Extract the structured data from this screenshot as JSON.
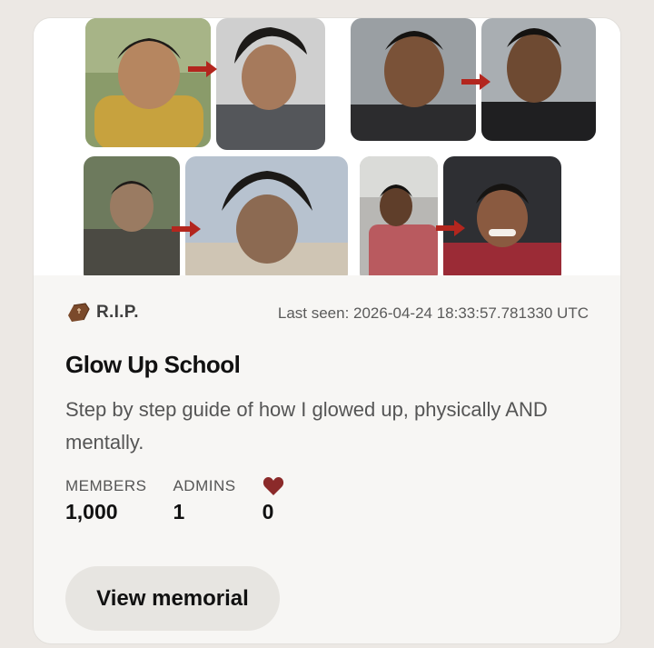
{
  "card": {
    "status_label": "R.I.P.",
    "last_seen": "Last seen: 2026-04-24 18:33:57.781330 UTC",
    "title": "Glow Up School",
    "description": "Step by step guide of how I glowed up, physically AND mentally.",
    "stats": {
      "members_label": "MEMBERS",
      "members_value": "1,000",
      "admins_label": "ADMINS",
      "admins_value": "1",
      "likes_value": "0"
    },
    "button_label": "View memorial"
  },
  "icons": {
    "status": "coffin-icon",
    "likes": "heart-icon",
    "arrows": "red-arrow-icon"
  },
  "colors": {
    "arrow": "#b3261e",
    "heart": "#8b2a2a",
    "button_bg": "#e7e5e1"
  }
}
